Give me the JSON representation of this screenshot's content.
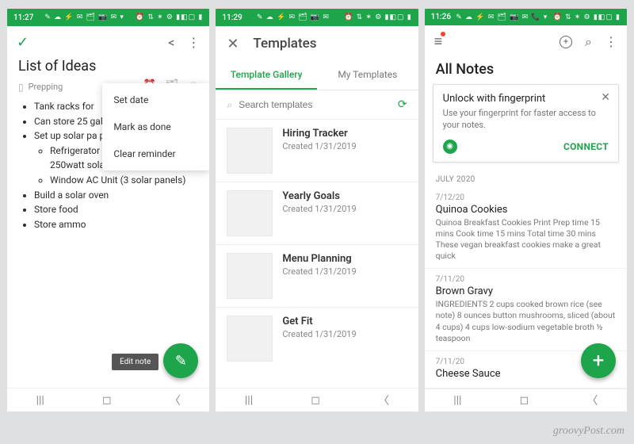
{
  "watermark": "groovyPost.com",
  "panel1": {
    "status": {
      "time": "11:27",
      "icons": "✎ ☁ ⚡ ✉ 🗂 📷 ✉ ▾",
      "right": "⏰ ⇅ ✶ ⚙ ▮◧▢ ▮"
    },
    "title": "List of Ideas",
    "notebook": "Prepping",
    "bullets": [
      "Tank racks for ",
      "Can store 25 gallon gallons across",
      "Set up solar pa power:",
      "Build a solar oven",
      "Store food",
      "Store ammo"
    ],
    "subbullets": [
      "Refrigerator and lights (3 200-250watt solar panels)",
      "Window AC Unit (3 solar panels)"
    ],
    "menu": {
      "set_date": "Set date",
      "mark_done": "Mark as done",
      "clear": "Clear reminder"
    },
    "edit_note": "Edit note"
  },
  "panel2": {
    "status": {
      "time": "11:29",
      "icons": "✎ ☁ ⚡ ✉ 🗂 📷 ✉",
      "right": "⏰ ⇅ ✶ ⚙ ▮◧▢ ▮"
    },
    "title": "Templates",
    "tabs": {
      "gallery": "Template Gallery",
      "mine": "My Templates"
    },
    "search_placeholder": "Search templates",
    "templates": [
      {
        "name": "Hiring Tracker",
        "date": "Created 1/31/2019"
      },
      {
        "name": "Yearly Goals",
        "date": "Created 1/31/2019"
      },
      {
        "name": "Menu Planning",
        "date": "Created 1/31/2019"
      },
      {
        "name": "Get Fit",
        "date": "Created 1/31/2019"
      }
    ]
  },
  "panel3": {
    "status": {
      "time": "11:26",
      "icons": "✎ ☁ ⚡ ✉ 🗂 📷 ✉ 📞 ▾",
      "right": "⏰ ⇅ ✶ ⚙ ▮◧▢ ▮"
    },
    "title": "All Notes",
    "unlock": {
      "title": "Unlock with fingerprint",
      "text": "Use your fingerprint for faster access to your notes.",
      "connect": "CONNECT"
    },
    "section": "JULY 2020",
    "notes": [
      {
        "date": "7/12/20",
        "title": "Quinoa Cookies",
        "text": "Quinoa Breakfast Cookies   Print Prep time 15 mins Cook time 15 mins Total time 30 mins   These vegan breakfast cookies make a great quick"
      },
      {
        "date": "7/11/20",
        "title": "Brown Gravy",
        "text": "INGREDIENTS 2 cups cooked brown rice (see note) 8 ounces button mushrooms, sliced (about 4 cups) 4 cups low-sodium vegetable broth ½ teaspoon"
      },
      {
        "date": "7/11/20",
        "title": "Cheese Sauce",
        "text": ""
      }
    ]
  }
}
